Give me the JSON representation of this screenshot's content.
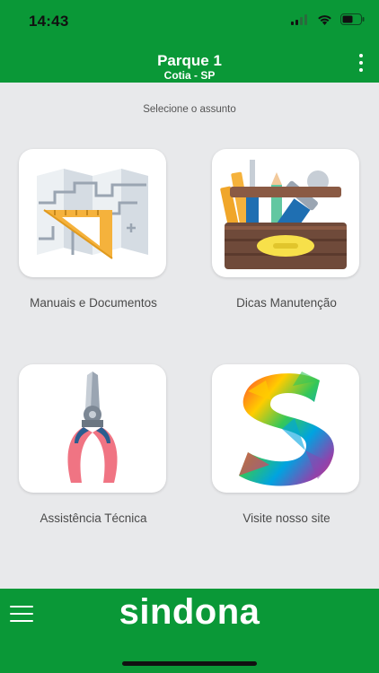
{
  "status": {
    "time": "14:43"
  },
  "header": {
    "title": "Parque 1",
    "subtitle": "Cotia - SP"
  },
  "prompt": "Selecione o assunto",
  "tiles": [
    {
      "label": "Manuais e Documentos",
      "icon": "map-ruler-icon"
    },
    {
      "label": "Dicas Manutenção",
      "icon": "toolbox-icon"
    },
    {
      "label": "Assistência Técnica",
      "icon": "pliers-icon"
    },
    {
      "label": "Visite nosso site",
      "icon": "sindona-s-logo-icon"
    }
  ],
  "footer": {
    "brand": "sindona"
  },
  "colors": {
    "primary_green": "#0a9837",
    "background": "#e8e9eb"
  }
}
